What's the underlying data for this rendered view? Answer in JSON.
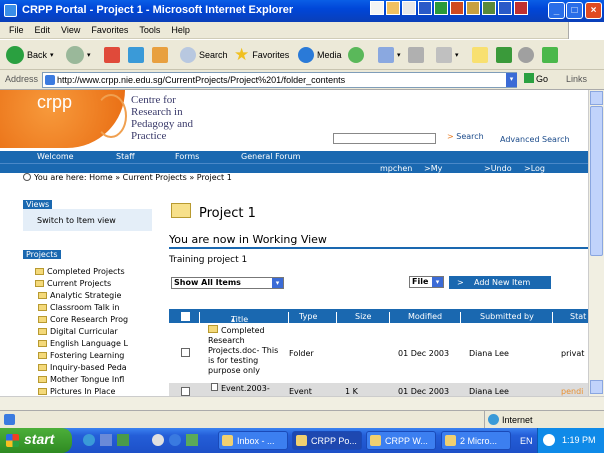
{
  "window": {
    "title": "CRPP Portal - Project 1 - Microsoft Internet Explorer"
  },
  "menu": [
    "File",
    "Edit",
    "View",
    "Favorites",
    "Tools",
    "Help"
  ],
  "toolbar": {
    "back": "Back",
    "search": "Search",
    "favorites": "Favorites",
    "media": "Media"
  },
  "address": {
    "label": "Address",
    "url": "http://www.crpp.nie.edu.sg/CurrentProjects/Project%201/folder_contents",
    "go": "Go",
    "links": "Links"
  },
  "site": {
    "logo": "crpp",
    "logo_lines": [
      "Centre for",
      "Research in",
      "Pedagogy and",
      "Practice"
    ],
    "search_button": "Search",
    "advanced_search": "Advanced Search",
    "nav": [
      "Welcome",
      "Staff",
      "Forms",
      "General Forum"
    ],
    "user": "mpchen",
    "user_links": [
      "My Profile",
      "Undo",
      "Log out"
    ],
    "breadcrumb": "You are here: Home » Current Projects » Project 1"
  },
  "left": {
    "views_title": "Views",
    "switch": "Switch to Item view",
    "projects_title": "Projects",
    "tree": [
      "Completed Projects",
      "Current Projects",
      "Analytic Strategie",
      "Classroom Talk in",
      "Core Research Prog",
      "Digital Curricular",
      "English Language L",
      "Fostering Learning",
      "Inquiry-based Peda",
      "Mother Tongue Infl",
      "Pictures In Place"
    ]
  },
  "main": {
    "title": "Project 1",
    "working_view": "You are now in Working View",
    "description": "Training project 1",
    "show_filter": "Show All Items",
    "file_select": "File",
    "add_new": "Add New Item",
    "columns": [
      "Title",
      "Type",
      "Size",
      "Modified",
      "Submitted by",
      "Stat"
    ],
    "rows": [
      {
        "title": "Completed Research Projects.doc- This is for testing purpose only",
        "type": "Folder",
        "size": "",
        "modified": "01 Dec 2003",
        "by": "Diana Lee",
        "status": "privat"
      },
      {
        "title": "Event.2003-",
        "type": "Event",
        "size": "1 K",
        "modified": "01 Dec 2003",
        "by": "Diana Lee",
        "status": "pendi"
      }
    ]
  },
  "status": {
    "zone": "Internet"
  },
  "taskbar": {
    "start": "start",
    "tasks": [
      "Inbox - ...",
      "CRPP Po...",
      "CRPP W...",
      "2 Micro..."
    ],
    "lang": "EN",
    "time": "1:19 PM"
  },
  "colors": {
    "accent": "#1a68b0",
    "logo": "#e86a10",
    "xp_blue": "#0046d8"
  }
}
